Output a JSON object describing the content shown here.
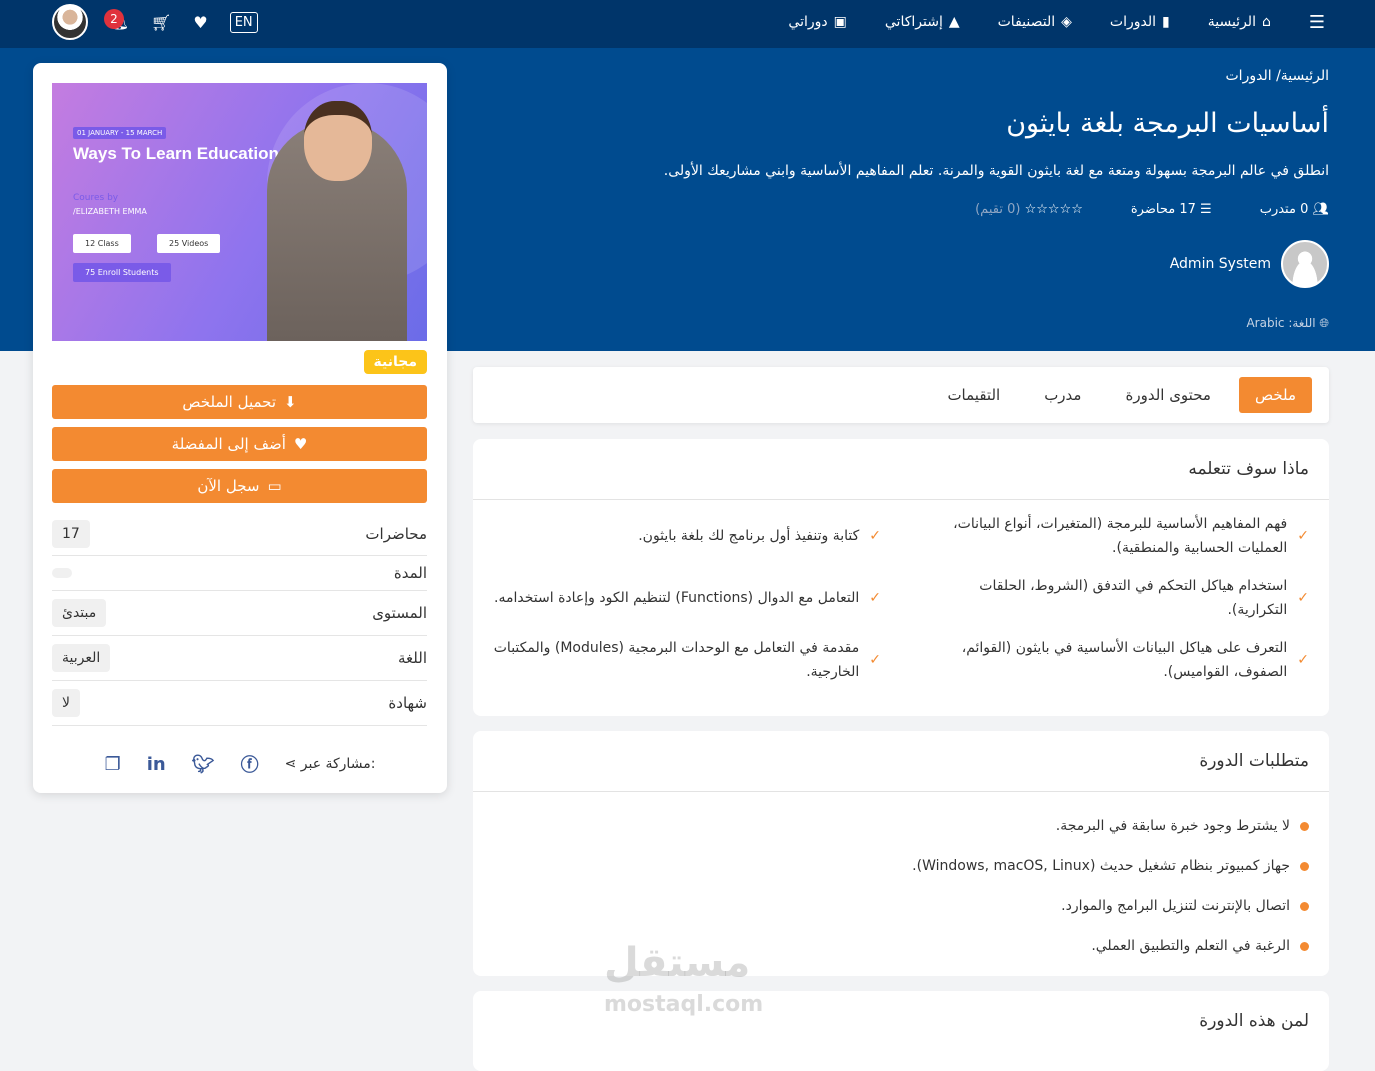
{
  "nav": {
    "home": "الرئيسية",
    "courses": "الدورات",
    "categories": "التصنيفات",
    "subscriptions": "إشتراكاتي",
    "my_courses": "دوراتي",
    "lang_toggle": "EN",
    "notif_count": "2"
  },
  "hero": {
    "breadcrumb_home": "الرئيسية/",
    "breadcrumb_current": "الدورات",
    "title": "أساسيات البرمجة بلغة بايثون",
    "description": "انطلق في عالم البرمجة بسهولة ومتعة مع لغة بايثون القوية والمرنة. تعلم المفاهيم الأساسية وابني مشاريعك الأولى.",
    "rating_text": "(0 تقيم)",
    "rating": 0,
    "lectures": "17 محاضرة",
    "students": "0 متدرب",
    "author": "Admin System",
    "language": "اللغة: Arabic"
  },
  "thumb": {
    "date": "01 JANUARY - 15 MARCH",
    "title": "Ways To Learn Education Effectively.",
    "by": "Coures by",
    "name": "/ELIZABETH EMMA",
    "class": "12 Class",
    "videos": "25 Videos",
    "students": "75 Enroll Students"
  },
  "side": {
    "free": "مجانية",
    "download": "تحميل الملخص",
    "favorite": "أضف إلى المفضلة",
    "enroll": "سجل الآن",
    "info": [
      {
        "label": "محاضرات",
        "value": "17"
      },
      {
        "label": "المدة",
        "value": ""
      },
      {
        "label": "المستوى",
        "value": "مبتدئ"
      },
      {
        "label": "اللغة",
        "value": "العربية"
      },
      {
        "label": "شهادة",
        "value": "لا"
      }
    ],
    "share": "مشاركة عبر:"
  },
  "tabs": [
    "ملخص",
    "محتوى الدورة",
    "مدرب",
    "التقيمات"
  ],
  "learn": {
    "title": "ماذا سوف تتعلمه",
    "items": [
      "فهم المفاهيم الأساسية للبرمجة (المتغيرات، أنواع البيانات، العمليات الحسابية والمنطقية).",
      "كتابة وتنفيذ أول برنامج لك بلغة بايثون.",
      "استخدام هياكل التحكم في التدفق (الشروط، الحلقات التكرارية).",
      "التعامل مع الدوال (Functions) لتنظيم الكود وإعادة استخدامه.",
      "التعرف على هياكل البيانات الأساسية في بايثون (القوائم، الصفوف، القواميس).",
      "مقدمة في التعامل مع الوحدات البرمجية (Modules) والمكتبات الخارجية."
    ]
  },
  "requirements": {
    "title": "متطلبات الدورة",
    "items": [
      "لا يشترط وجود خبرة سابقة في البرمجة.",
      "جهاز كمبيوتر بنظام تشغيل حديث (Windows, macOS, Linux).",
      "اتصال بالإنترنت لتنزيل البرامج والموارد.",
      "الرغبة في التعلم والتطبيق العملي."
    ]
  },
  "audience": {
    "title": "لمن هذه الدورة"
  },
  "watermark": {
    "ar": "مستقل",
    "en": "mostaql.com"
  }
}
